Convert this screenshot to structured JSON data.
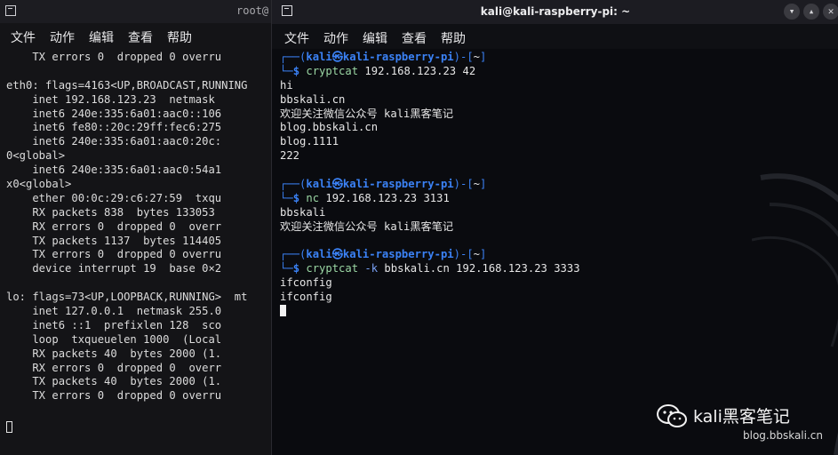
{
  "left_window": {
    "title": "root@",
    "menu": [
      "文件",
      "动作",
      "编辑",
      "查看",
      "帮助"
    ],
    "lines": [
      "    TX errors 0  dropped 0 overru",
      "",
      "eth0: flags=4163<UP,BROADCAST,RUNNING",
      "    inet 192.168.123.23  netmask",
      "    inet6 240e:335:6a01:aac0::106",
      "    inet6 fe80::20c:29ff:fec6:275",
      "    inet6 240e:335:6a01:aac0:20c:",
      "0<global>",
      "    inet6 240e:335:6a01:aac0:54a1",
      "x0<global>",
      "    ether 00:0c:29:c6:27:59  txqu",
      "    RX packets 838  bytes 133053",
      "    RX errors 0  dropped 0  overr",
      "    TX packets 1137  bytes 114405",
      "    TX errors 0  dropped 0 overru",
      "    device interrupt 19  base 0×2",
      "",
      "lo: flags=73<UP,LOOPBACK,RUNNING>  mt",
      "    inet 127.0.0.1  netmask 255.0",
      "    inet6 ::1  prefixlen 128  sco",
      "    loop  txqueuelen 1000  (Local",
      "    RX packets 40  bytes 2000 (1.",
      "    RX errors 0  dropped 0  overr",
      "    TX packets 40  bytes 2000 (1.",
      "    TX errors 0  dropped 0 overru"
    ]
  },
  "right_window": {
    "title": "kali@kali-raspberry-pi: ~",
    "menu": [
      "文件",
      "动作",
      "编辑",
      "查看",
      "帮助"
    ],
    "prompt": {
      "corner_top": "┌──(",
      "user": "kali㉿kali-raspberry-pi",
      "mid": ")-[",
      "dir": "~",
      "end": "]",
      "corner_bottom": "└─",
      "dollar": "$"
    },
    "sessions": [
      {
        "cmd": "cryptcat",
        "flag": "",
        "args": " 192.168.123.23 42",
        "output": [
          "hi",
          "bbskali.cn",
          "欢迎关注微信公众号 kali黑客笔记",
          "blog.bbskali.cn",
          "blog.1111",
          "222"
        ]
      },
      {
        "cmd": "nc",
        "flag": "",
        "args": " 192.168.123.23 3131",
        "output": [
          "bbskali",
          "欢迎关注微信公众号 kali黑客笔记"
        ]
      },
      {
        "cmd": "cryptcat",
        "flag": " -k",
        "args": " bbskali.cn 192.168.123.23 3333",
        "output": [
          "ifconfig",
          "ifconfig"
        ]
      }
    ]
  },
  "watermark": {
    "name": "kali黑客笔记",
    "url": "blog.bbskali.cn"
  },
  "colors": {
    "prompt_blue": "#3b82f6",
    "command_green": "#9bd7a4",
    "flag_blue": "#7aa2f7"
  }
}
